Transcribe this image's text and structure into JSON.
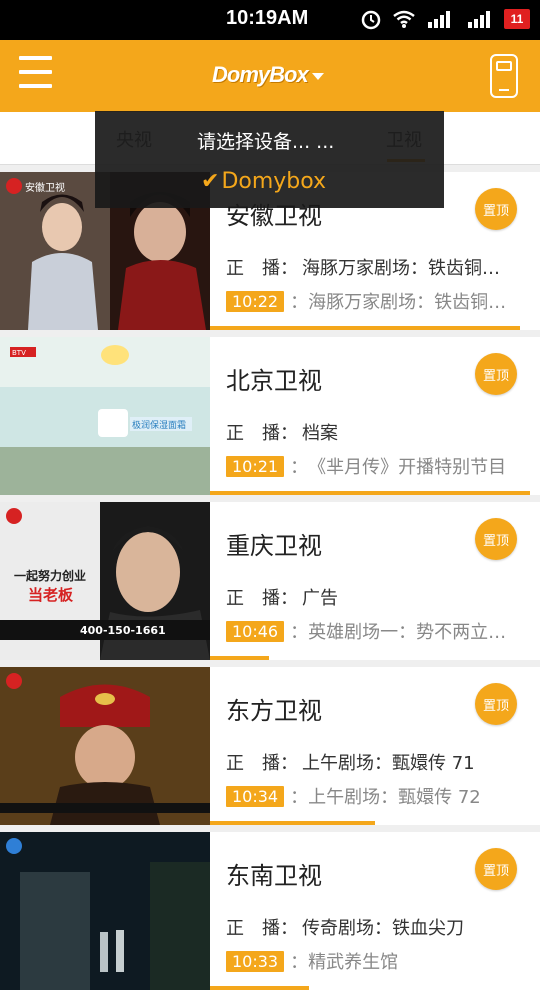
{
  "status_bar": {
    "time": "10:19AM",
    "battery_level": "11"
  },
  "app_bar": {
    "brand": "DomyBox"
  },
  "tabs": [
    {
      "label": "央视"
    },
    {
      "label": "卫视",
      "active": true
    }
  ],
  "device_dropdown": {
    "title": "请选择设备... ...",
    "devices": [
      {
        "name": "Domybox",
        "selected": true
      }
    ]
  },
  "channels": [
    {
      "name": "安徽卫视",
      "pin_label": "置顶",
      "now_label": "正　播：",
      "now_program": "海豚万家剧场：铁齿铜…",
      "next_time": "10:22",
      "next_program": "海豚万家剧场：铁齿铜…",
      "progress": 0.94
    },
    {
      "name": "北京卫视",
      "pin_label": "置顶",
      "now_label": "正　播：",
      "now_program": "档案",
      "next_time": "10:21",
      "next_program": "《芈月传》开播特别节目",
      "progress": 0.97
    },
    {
      "name": "重庆卫视",
      "pin_label": "置顶",
      "now_label": "正　播：",
      "now_program": "广告",
      "next_time": "10:46",
      "next_program": "英雄剧场一：势不两立…",
      "progress": 0.18
    },
    {
      "name": "东方卫视",
      "pin_label": "置顶",
      "now_label": "正　播：",
      "now_program": "上午剧场：甄嬛传 71",
      "next_time": "10:34",
      "next_program": "上午剧场：甄嬛传 72",
      "progress": 0.5
    },
    {
      "name": "东南卫视",
      "pin_label": "置顶",
      "now_label": "正　播：",
      "now_program": "传奇剧场：铁血尖刀",
      "next_time": "10:33",
      "next_program": "精武养生馆",
      "progress": 0.3
    }
  ],
  "colors": {
    "accent": "#f4a71b",
    "status_bar": "#000000",
    "battery": "#e02020"
  }
}
